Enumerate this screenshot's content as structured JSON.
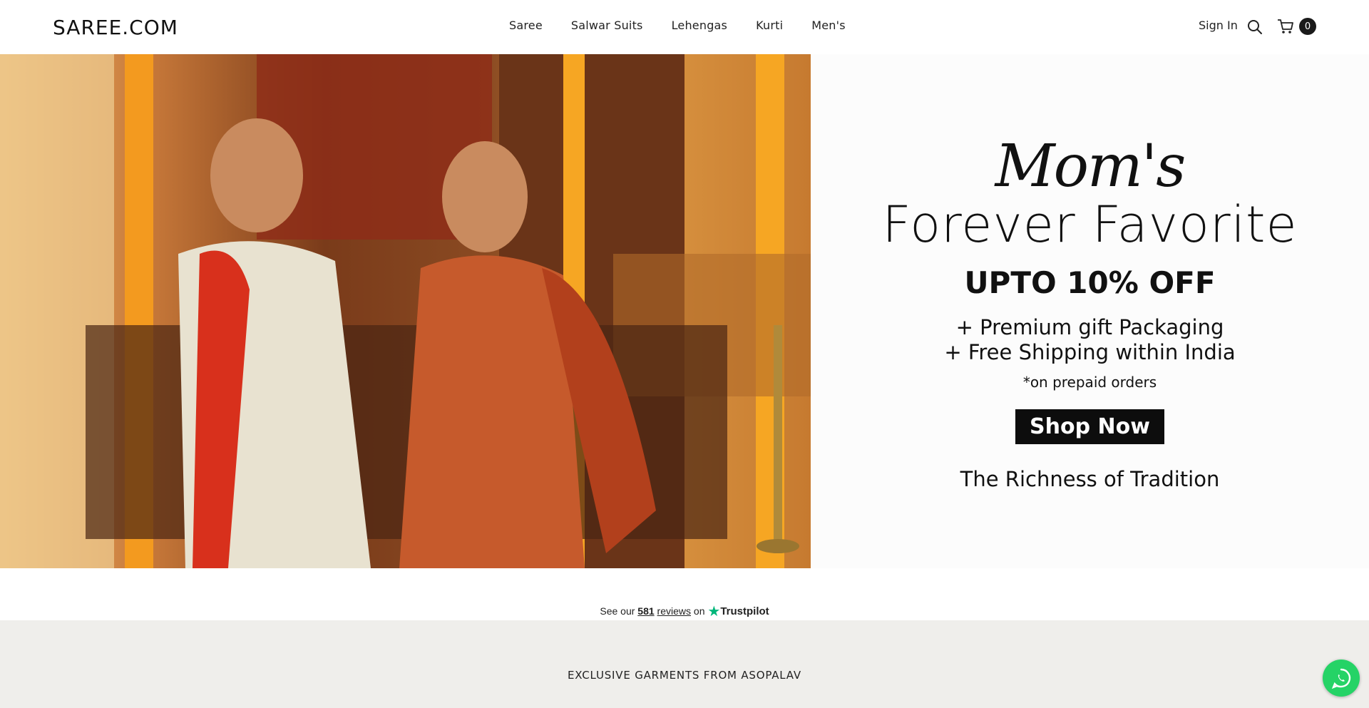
{
  "header": {
    "logo": "SAREE.COM",
    "nav": [
      "Saree",
      "Salwar Suits",
      "Lehengas",
      "Kurti",
      "Men's"
    ],
    "sign_in": "Sign In",
    "cart_count": "0"
  },
  "hero": {
    "script_title": "Mom's",
    "title": "Forever Favorite",
    "offer": "UPTO 10% OFF",
    "perk1": "+ Premium gift Packaging",
    "perk2": "+ Free Shipping within India",
    "note": "*on prepaid orders",
    "cta": "Shop Now",
    "tagline": "The Richness of Tradition"
  },
  "trustpilot": {
    "prefix": "See our",
    "count": "581",
    "reviews": "reviews",
    "on": "on",
    "brand": "Trustpilot"
  },
  "section": {
    "title": "EXCLUSIVE GARMENTS FROM ASOPALAV"
  },
  "icons": {
    "search": "search-icon",
    "cart": "cart-icon",
    "whatsapp": "whatsapp-icon",
    "star": "trustpilot-star-icon"
  },
  "colors": {
    "accent_black": "#0d0d0d",
    "band": "#efeeeb",
    "trustpilot_green": "#00b67a",
    "whatsapp_green": "#25d366"
  }
}
